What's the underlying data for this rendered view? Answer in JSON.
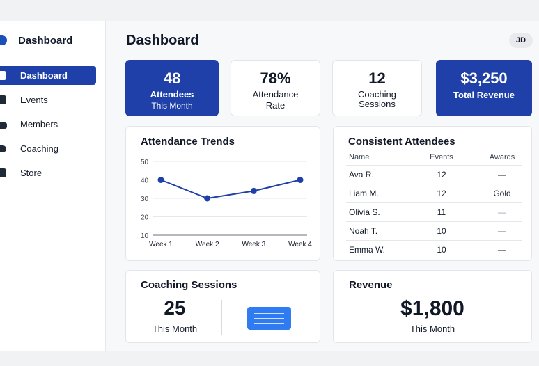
{
  "sidebar": {
    "brand": "Dashboard",
    "items": [
      {
        "label": "Dashboard",
        "active": true,
        "icon": "dashboard-icon"
      },
      {
        "label": "Events",
        "active": false,
        "icon": "calendar-icon"
      },
      {
        "label": "Members",
        "active": false,
        "icon": "user-icon"
      },
      {
        "label": "Coaching",
        "active": false,
        "icon": "coaching-icon"
      },
      {
        "label": "Store",
        "active": false,
        "icon": "store-icon"
      }
    ]
  },
  "header": {
    "title": "Dashboard",
    "avatar_initials": "JD"
  },
  "stats": [
    {
      "value": "48",
      "label": "Attendees",
      "sub": "This Month"
    },
    {
      "value": "78%",
      "label": "Attendance",
      "sub": "Rate"
    },
    {
      "value": "12",
      "label": "Coaching",
      "sub": "Sessions"
    },
    {
      "value": "$3,250",
      "label": "Total Revenue"
    }
  ],
  "attendance": {
    "title": "Attendance Trends"
  },
  "chart_data": {
    "type": "line",
    "categories": [
      "Week 1",
      "Week 2",
      "Week 3",
      "Week 4"
    ],
    "series": [
      {
        "values": [
          40,
          30,
          34,
          40
        ]
      }
    ],
    "yticks": [
      10,
      20,
      30,
      40,
      50
    ],
    "ylim": [
      10,
      50
    ],
    "color": "#1e40a8",
    "grid": true
  },
  "consistent": {
    "title": "Consistent Attendees",
    "columns": [
      "Name",
      "Events",
      "Awards"
    ],
    "rows": [
      {
        "name": "Ava R.",
        "events": "12",
        "awards": "—"
      },
      {
        "name": "Liam M.",
        "events": "12",
        "awards": "Gold"
      },
      {
        "name": "Olivia S.",
        "events": "11",
        "awards": "—"
      },
      {
        "name": "Noah T.",
        "events": "10",
        "awards": "—"
      },
      {
        "name": "Emma W.",
        "events": "10",
        "awards": "—"
      }
    ]
  },
  "coaching": {
    "title": "Coaching Sessions",
    "value": "25",
    "sub": "This Month"
  },
  "revenue": {
    "title": "Revenue",
    "value": "$1,800",
    "sub": "This Month"
  },
  "colors": {
    "primary": "#1e40a8",
    "accent": "#2f7cf2"
  }
}
